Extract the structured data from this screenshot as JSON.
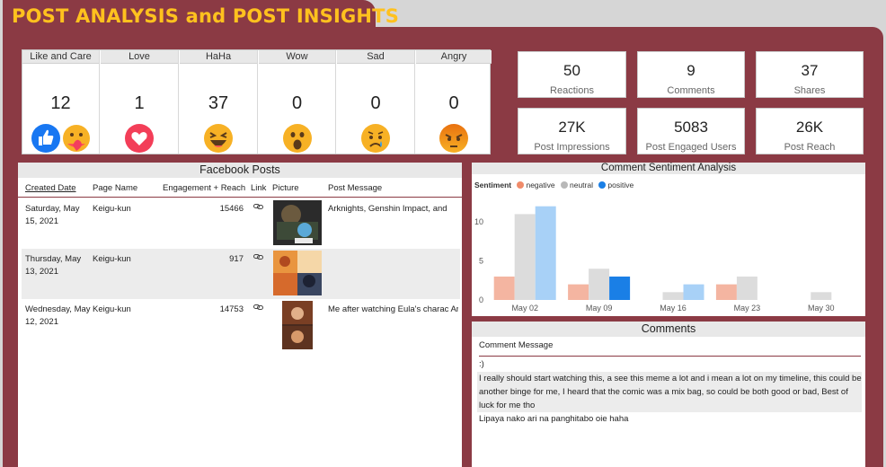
{
  "title": "POST ANALYSIS and POST INSIGHTS",
  "reactions": [
    {
      "label": "Like and Care",
      "value": "12"
    },
    {
      "label": "Love",
      "value": "1"
    },
    {
      "label": "HaHa",
      "value": "37"
    },
    {
      "label": "Wow",
      "value": "0"
    },
    {
      "label": "Sad",
      "value": "0"
    },
    {
      "label": "Angry",
      "value": "0"
    }
  ],
  "kpis": [
    {
      "value": "50",
      "label": "Reactions"
    },
    {
      "value": "9",
      "label": "Comments"
    },
    {
      "value": "37",
      "label": "Shares"
    },
    {
      "value": "27K",
      "label": "Post Impressions"
    },
    {
      "value": "5083",
      "label": "Post Engaged Users"
    },
    {
      "value": "26K",
      "label": "Post Reach"
    }
  ],
  "posts": {
    "title": "Facebook Posts",
    "columns": [
      "Created Date",
      "Page Name",
      "Engagement + Reach",
      "Link",
      "Picture",
      "Post Message"
    ],
    "rows": [
      {
        "date": "Saturday, May 15, 2021",
        "page": "Keigu-kun",
        "engagement": "15466",
        "message": "Arknights, Genshin Impact, and"
      },
      {
        "date": "Thursday, May 13, 2021",
        "page": "Keigu-kun",
        "engagement": "917",
        "message": ""
      },
      {
        "date": "Wednesday, May 12, 2021",
        "page": "Keigu-kun",
        "engagement": "14753",
        "message": "Me after watching Eula's charac Arknights"
      }
    ]
  },
  "sentiment": {
    "title": "Comment Sentiment Analysis",
    "legend_title": "Sentiment",
    "colors": {
      "negative": "#f4b5a1",
      "neutral": "#dcdcdc",
      "positive": "#a8d1f7",
      "positive_highlight": "#1a7fe6"
    }
  },
  "chart_data": {
    "type": "bar",
    "categories": [
      "May 02",
      "May 09",
      "May 16",
      "May 23",
      "May 30"
    ],
    "series": [
      {
        "name": "negative",
        "values": [
          3,
          2,
          0,
          2,
          0
        ]
      },
      {
        "name": "neutral",
        "values": [
          11,
          4,
          1,
          3,
          1
        ]
      },
      {
        "name": "positive",
        "values": [
          12,
          3,
          2,
          0,
          0
        ]
      }
    ],
    "yticks": [
      0,
      5,
      10
    ],
    "ylim": [
      0,
      13
    ],
    "highlight_category": "May 09",
    "legend": "top-left"
  },
  "comments": {
    "title": "Comments",
    "column": "Comment Message",
    "rows": [
      ":)",
      "I really should start watching this, a see this meme a lot and i mean a lot on my timeline, this could be another binge for me, I heard that the comic was a mix bag, so could be both good or bad, Best of luck for me tho",
      "Lipaya nako ari na panghitabo oie haha"
    ]
  }
}
